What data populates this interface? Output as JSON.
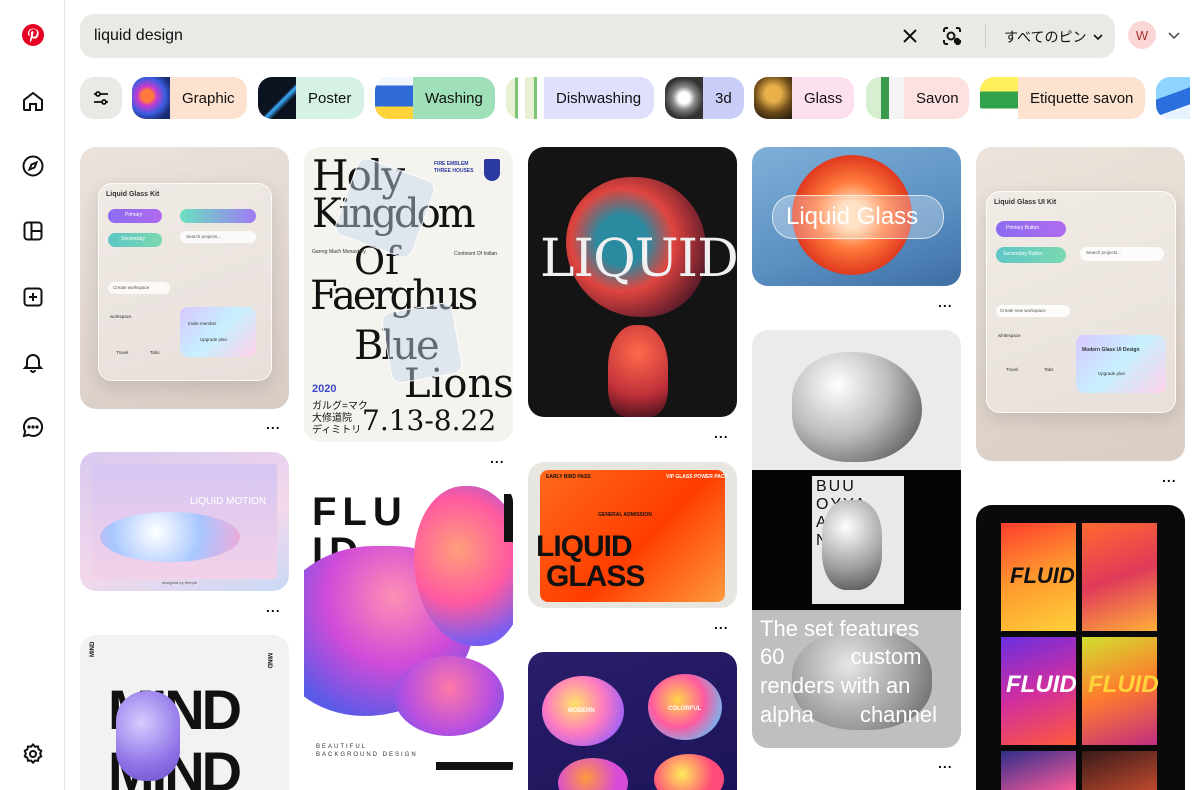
{
  "search": {
    "query": "liquid design",
    "filter_label": "すべてのピン"
  },
  "account": {
    "initial": "W"
  },
  "chips": [
    {
      "label": "Graphic",
      "bg": "#fde2cf"
    },
    {
      "label": "Poster",
      "bg": "#d6f2e5"
    },
    {
      "label": "Washing",
      "bg": "#9fe0b8"
    },
    {
      "label": "Dishwashing",
      "bg": "#dfe0fb"
    },
    {
      "label": "3d",
      "bg": "#c9cdf8"
    },
    {
      "label": "Glass",
      "bg": "#fde0ef"
    },
    {
      "label": "Savon",
      "bg": "#fde0e0"
    },
    {
      "label": "Etiquette savon",
      "bg": "#fde2cf"
    }
  ],
  "more_label": "...",
  "pins": {
    "kit_left": {
      "title": "Liquid Glass Kit",
      "primary": "Primary",
      "secondary": "Secondary",
      "search": "Search projects...",
      "create": "Create workspace",
      "workspace": "workspace",
      "invite": "Invite member",
      "upgrade": "Upgrade plan",
      "travel": "Travel",
      "tabs": "Tabs"
    },
    "holy": {
      "line1": "Holy",
      "line2": "Kingdom",
      "line3": "Of",
      "line4": "Faerghus",
      "line5": "Blue",
      "line6": "Lions",
      "year": "2020",
      "jp1": "ガルグ=マク",
      "jp2": "大修道院",
      "jp3": "ディミトリ",
      "dates": "7.13-8.22",
      "side1": "FIRE EMBLEM",
      "side2": "THREE HOUSES",
      "monastery": "Garreg Mach Monastery",
      "continent": "Continent Of Indian"
    },
    "liquid_dark": {
      "word": "LIQUID"
    },
    "liquid_glass_flower": {
      "word": "Liquid Glass"
    },
    "kit_right": {
      "title": "Liquid Glass UI Kit",
      "primary": "Primary Button",
      "secondary": "Secondary Button",
      "search": "Search projects...",
      "create": "Create new workspace",
      "whitespace": "whitespace",
      "modern": "Modern Glass UI Design",
      "travel": "Travel",
      "tabs": "Tabs",
      "upgrade": "Upgrade plan"
    },
    "liquid_motion": {
      "word": "LIQUID MOTION",
      "credit": "designed by freepik"
    },
    "fluid": {
      "line1": "FLU",
      "line2": "ID.",
      "bg1": "BEAUTIFUL",
      "bg2": "BACKGROUND DESIGN"
    },
    "liquid_orange": {
      "line1": "LIQUID",
      "line2": "GLASS",
      "tag1": "EARLY BIRD PASS",
      "tag2": "VIP GLASS POWER PACK",
      "tag3": "GENERAL ADMISSION"
    },
    "bubbles": {
      "text1": "The set features",
      "text2": "60 custom",
      "text3": "renders with an",
      "text4": "alpha channel",
      "letters": "BUU OYYA ANN NNY Y"
    },
    "fluid_posters": {
      "word": "FLUID"
    },
    "mind": {
      "word": "MIND",
      "side": "MIND"
    },
    "modern_blobs": {
      "w1": "MODERN",
      "w2": "COLORFUL"
    }
  },
  "colors": {
    "brand_red": "#e60023",
    "chip_gray": "#e9e9e5"
  }
}
